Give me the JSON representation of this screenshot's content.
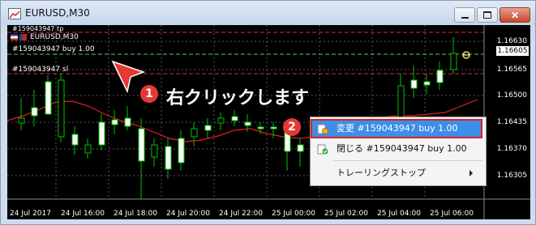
{
  "window": {
    "title": "EURUSD,M30"
  },
  "chart": {
    "symbol_label": "EURUSD,M30",
    "order_tp_label": "#159043947 tp",
    "order_buy_label": "#159043947 buy 1.00",
    "order_sl_label": "#159043947 sl",
    "price_axis": [
      "1.16630",
      "1.16565",
      "1.16500",
      "1.16435",
      "1.16370",
      "1.16305"
    ],
    "current_price": "1.16605",
    "time_axis": [
      "24 Jul 2017",
      "24 Jul 16:00",
      "24 Jul 18:00",
      "24 Jul 20:00",
      "24 Jul 22:00",
      "25 Jul 00:00",
      "25 Jul 02:00",
      "25 Jul 04:00",
      "25 Jul 06:00"
    ]
  },
  "callouts": {
    "step1_number": "1",
    "step1_text": "右クリックします",
    "step2_number": "2"
  },
  "context_menu": {
    "items": [
      {
        "label": "変更 #159043947 buy 1.00",
        "icon": "modify-order-icon",
        "highlighted": true
      },
      {
        "label": "閉じる #159043947 buy 1.00",
        "icon": "close-order-icon",
        "highlighted": false
      },
      {
        "label": "トレーリングストップ",
        "icon": "",
        "submenu": true
      }
    ]
  },
  "colors": {
    "chart_bg": "#000000",
    "bull_candle": "#ffffff",
    "wick": "#00c000",
    "ma_line": "#e02020",
    "level_line": "#e03030",
    "highlight": "#3d8ee8",
    "badge": "#e53935"
  }
}
